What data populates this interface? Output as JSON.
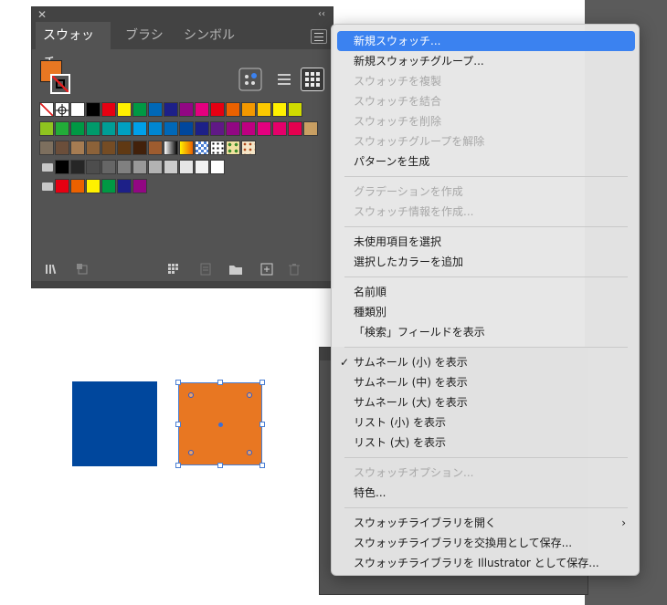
{
  "swatches_panel": {
    "tabs": [
      {
        "label": "スウォッチ",
        "active": true
      },
      {
        "label": "ブラシ",
        "active": false
      },
      {
        "label": "シンボル",
        "active": false
      }
    ],
    "fill_color": "#e87722",
    "rows": [
      {
        "folder": false,
        "colors": [
          "none",
          "registration",
          "#ffffff",
          "#000000",
          "#e60012",
          "#fff100",
          "#009944",
          "#0068b7",
          "#1d2088",
          "#920783",
          "#e4007f",
          "#e60012",
          "#eb6100",
          "#f39800",
          "#fcc800",
          "#fff100",
          "#cfdb00"
        ]
      },
      {
        "folder": false,
        "colors": [
          "#8fc31f",
          "#22ac38",
          "#009944",
          "#009b6b",
          "#009e96",
          "#00a0c1",
          "#00a0e9",
          "#0086d1",
          "#0068b7",
          "#00479d",
          "#1d2088",
          "#601986",
          "#920783",
          "#be0081",
          "#e4007f",
          "#e5006a",
          "#e5004f",
          "#c9a063"
        ]
      },
      {
        "folder": false,
        "colors": [
          "#7d6f5e",
          "#6b4e3a",
          "#a67c52",
          "#8c6239",
          "#754c24",
          "#603913",
          "#42210b",
          "#9e5c2f",
          "grad-bw",
          "grad-orange",
          "pattern-check",
          "pattern-dots",
          "pattern-leaf",
          "pattern-flower"
        ]
      },
      {
        "folder": true,
        "colors": [
          "#000000",
          "#262626",
          "#4d4d4d",
          "#666666",
          "#808080",
          "#999999",
          "#b3b3b3",
          "#cccccc",
          "#e6e6e6",
          "#f2f2f2",
          "#ffffff"
        ]
      },
      {
        "folder": true,
        "colors": [
          "#e60012",
          "#eb6100",
          "#fff100",
          "#009944",
          "#1d2088",
          "#920783"
        ]
      }
    ],
    "view_icons": [
      "show-kinds-icon",
      "list-view-icon",
      "thumbnail-view-icon"
    ],
    "footer_icons": [
      "swatch-libraries-icon",
      "place-swatches-icon",
      "show-kinds-menu-icon",
      "swatch-options-icon",
      "new-color-group-icon",
      "new-swatch-icon",
      "delete-swatch-icon"
    ]
  },
  "menu": {
    "items": [
      {
        "label": "新規スウォッチ...",
        "state": "highlighted"
      },
      {
        "label": "新規スウォッチグループ...",
        "state": "enabled"
      },
      {
        "label": "スウォッチを複製",
        "state": "disabled"
      },
      {
        "label": "スウォッチを結合",
        "state": "disabled"
      },
      {
        "label": "スウォッチを削除",
        "state": "disabled"
      },
      {
        "label": "スウォッチグループを解除",
        "state": "disabled"
      },
      {
        "label": "パターンを生成",
        "state": "enabled"
      },
      {
        "separator": true
      },
      {
        "label": "グラデーションを作成",
        "state": "disabled"
      },
      {
        "label": "スウォッチ情報を作成...",
        "state": "disabled"
      },
      {
        "separator": true
      },
      {
        "label": "未使用項目を選択",
        "state": "enabled"
      },
      {
        "label": "選択したカラーを追加",
        "state": "enabled"
      },
      {
        "separator": true
      },
      {
        "label": "名前順",
        "state": "enabled"
      },
      {
        "label": "種類別",
        "state": "enabled"
      },
      {
        "label": "「検索」フィールドを表示",
        "state": "enabled"
      },
      {
        "separator": true
      },
      {
        "label": "サムネール (小) を表示",
        "state": "enabled",
        "checked": true
      },
      {
        "label": "サムネール (中) を表示",
        "state": "enabled"
      },
      {
        "label": "サムネール (大) を表示",
        "state": "enabled"
      },
      {
        "label": "リスト (小) を表示",
        "state": "enabled"
      },
      {
        "label": "リスト (大) を表示",
        "state": "enabled"
      },
      {
        "separator": true
      },
      {
        "label": "スウォッチオプション...",
        "state": "disabled"
      },
      {
        "label": "特色...",
        "state": "enabled"
      },
      {
        "separator": true
      },
      {
        "label": "スウォッチライブラリを開く",
        "state": "enabled",
        "submenu": true
      },
      {
        "label": "スウォッチライブラリを交換用として保存...",
        "state": "enabled"
      },
      {
        "label": "スウォッチライブラリを Illustrator として保存...",
        "state": "enabled"
      }
    ]
  },
  "artboard": {
    "blue_square_color": "#00479d",
    "orange_square_color": "#e87722"
  }
}
